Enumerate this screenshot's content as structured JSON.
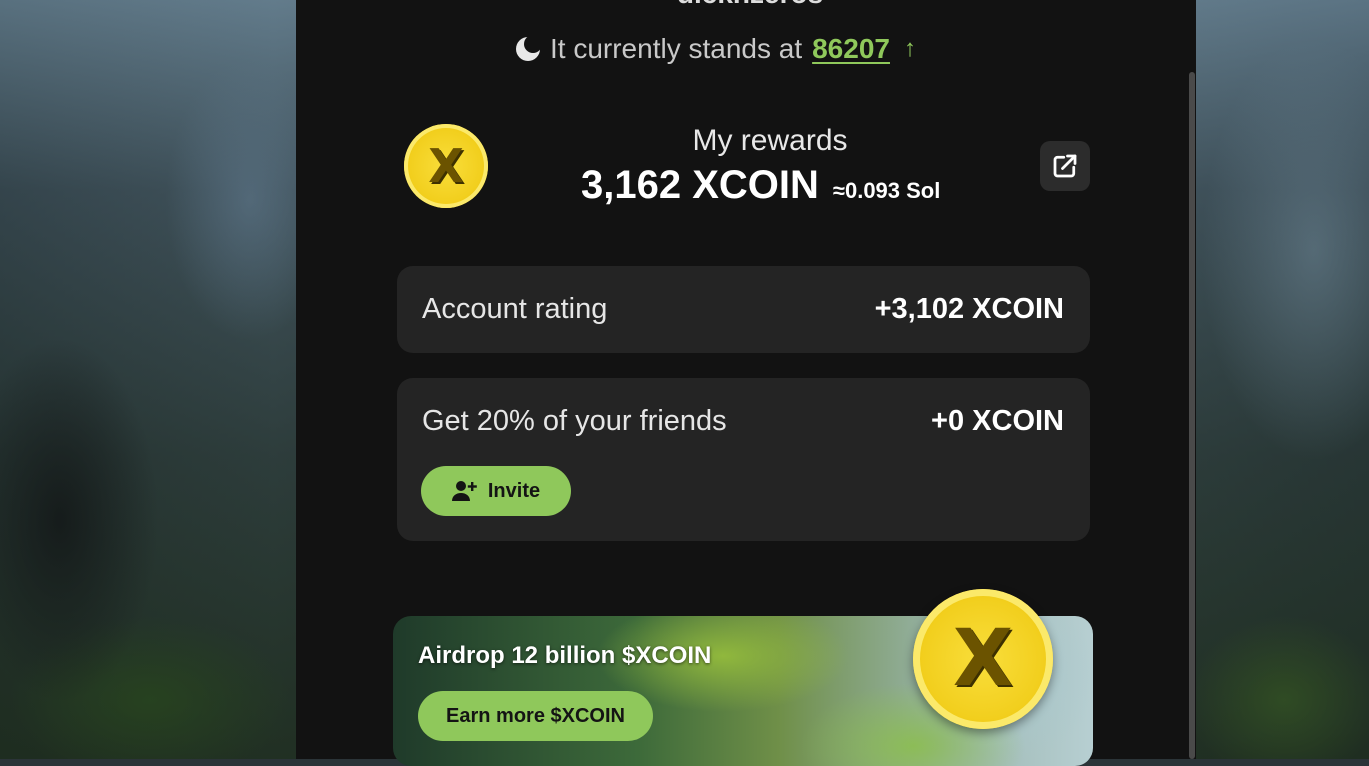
{
  "header": {
    "title_partial": "dicknzeros",
    "stands_prefix": "It currently stands at",
    "stands_value": "86207",
    "stands_arrow": "↑"
  },
  "rewards": {
    "label": "My rewards",
    "amount": "3,162 XCOIN",
    "sol_equivalent": "≈0.093 Sol",
    "coin_letter": "X",
    "external_icon": "external-link-icon"
  },
  "cards": {
    "account_rating": {
      "label": "Account rating",
      "amount": "+3,102 XCOIN"
    },
    "friends": {
      "label": "Get 20% of your friends",
      "amount": "+0 XCOIN",
      "invite_label": "Invite",
      "invite_icon": "add-user-icon"
    }
  },
  "banner": {
    "title": "Airdrop 12 billion $XCOIN",
    "button_label": "Earn more $XCOIN",
    "coin_letter": "X"
  },
  "colors": {
    "accent_green": "#8fc85b",
    "panel_bg": "#121212",
    "card_bg": "#242424",
    "coin_yellow": "#f2cf1e"
  }
}
